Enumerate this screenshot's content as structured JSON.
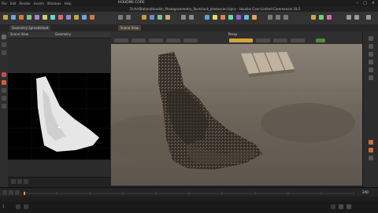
{
  "window": {
    "menu_items": [
      "File",
      "Edit",
      "Render",
      "Assets",
      "Windows",
      "Help"
    ],
    "title_short": "HOUDINI CORE",
    "title": "D:/ArtStation/Houdini_Photogrammetry_Rock/rock_photoscan.hipnc - Houdini Core Limited Commercial 19.5"
  },
  "tabs": {
    "network": "Scene View",
    "left": "Geometry Spreadsheet"
  },
  "viewport": {
    "label": "Persp",
    "accent": "#d4a43a"
  },
  "left_panel": {
    "header_a": "Scene View",
    "header_b": "Geometry"
  },
  "timeline": {
    "frame": "1",
    "end": "240"
  },
  "colors": {
    "accent": "#e0a23a",
    "bg": "#2a2a2a",
    "viewport_bg": "#6b6257"
  }
}
